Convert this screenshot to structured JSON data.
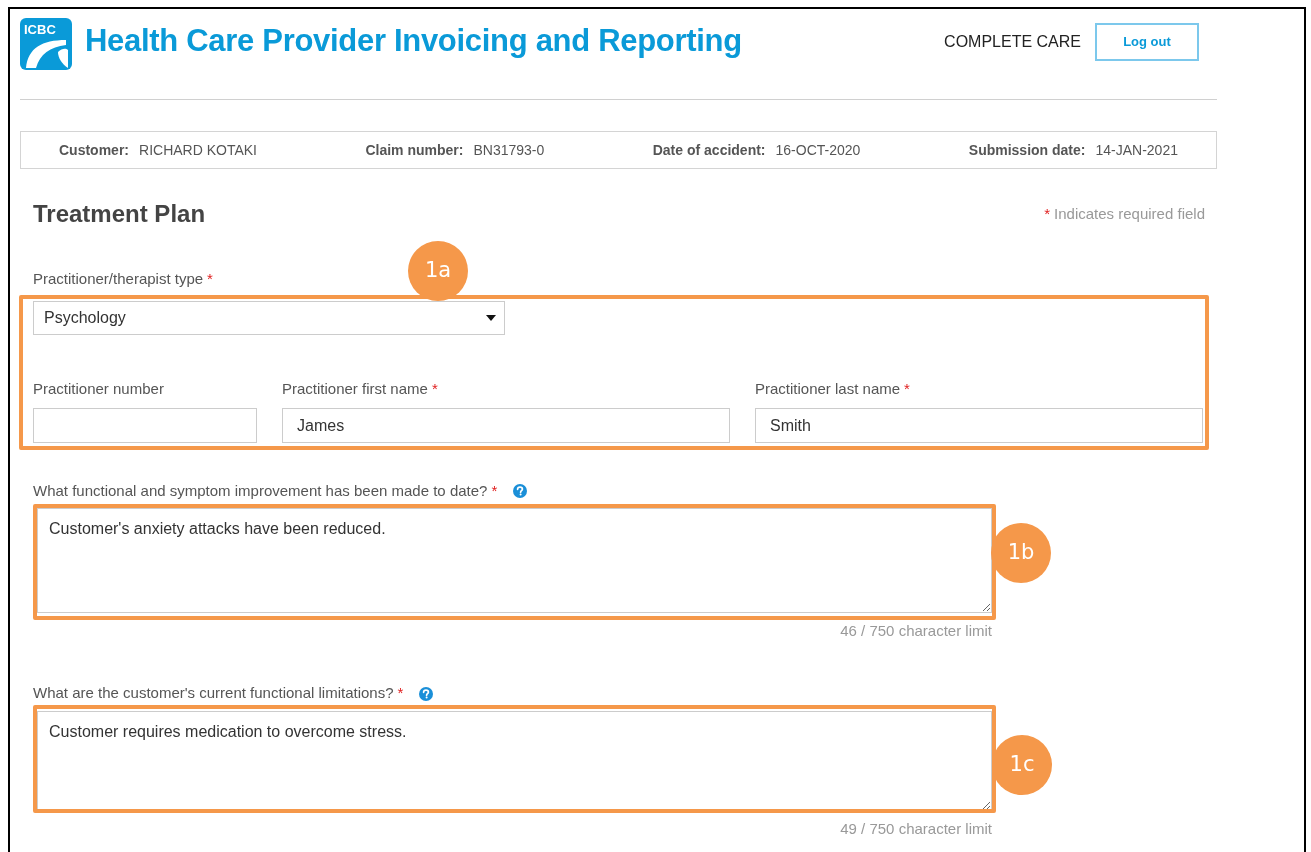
{
  "header": {
    "logo_text": "ICBC",
    "title": "Health Care Provider Invoicing and Reporting",
    "user": "COMPLETE CARE",
    "logout_button": "Log out"
  },
  "claim_info": [
    {
      "label": "Customer:",
      "value": "RICHARD KOTAKI"
    },
    {
      "label": "Claim number:",
      "value": "BN31793-0"
    },
    {
      "label": "Date of accident:",
      "value": "16-OCT-2020"
    },
    {
      "label": "Submission date:",
      "value": "14-JAN-2021"
    }
  ],
  "form": {
    "title": "Treatment Plan",
    "required_note": {
      "mark": "*",
      "text": "Indicates required field"
    },
    "practitioner_type": {
      "label": "Practitioner/therapist type",
      "mark": "*",
      "value": "Psychology"
    },
    "practitioner_fields": [
      {
        "label": "Practitioner number"
      },
      {
        "label": "Practitioner first name",
        "mark": "*",
        "value": "James"
      },
      {
        "label": "Practitioner last name",
        "mark": "*",
        "value": "Smith"
      }
    ],
    "questions": [
      {
        "label": "What functional and symptom improvement has been made to date?",
        "mark": "*",
        "help": true,
        "value": "Customer's anxiety attacks have been reduced.",
        "counter": "46 / 750 character limit"
      },
      {
        "label": "What are the customer's current functional limitations?",
        "mark": "*",
        "help": true,
        "value": "Customer requires medication to overcome stress.",
        "counter": "49 / 750 character limit"
      }
    ]
  },
  "annotations": [
    {
      "label": "1a"
    },
    {
      "label": "1b"
    },
    {
      "label": "1c"
    }
  ]
}
